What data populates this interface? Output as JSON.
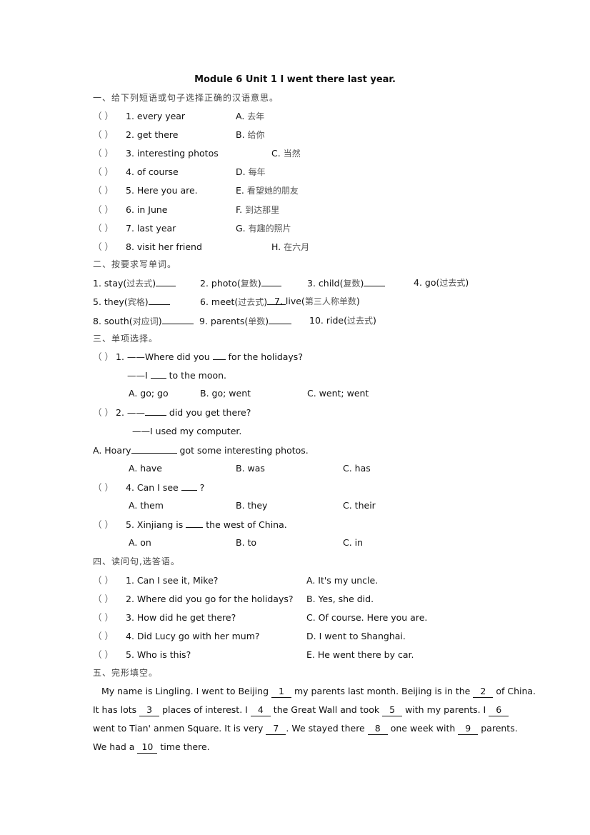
{
  "title": "Module 6 Unit 1 I went there last year.",
  "section1": {
    "heading": "一、给下列短语或句子选择正确的汉语意思。",
    "items": [
      {
        "paren": "（  ）",
        "q": "1. every year",
        "opt": "A.",
        "optcn": "去年"
      },
      {
        "paren": "（  ）",
        "q": "2. get there",
        "opt": "B.",
        "optcn": "给你"
      },
      {
        "paren": "（  ）",
        "q": "3. interesting photos",
        "opt": "C.",
        "optcn": "当然"
      },
      {
        "paren": "（  ）",
        "q": "4. of course",
        "opt": "D.",
        "optcn": "每年"
      },
      {
        "paren": "（  ）",
        "q": "5. Here you are.",
        "opt": "E.",
        "optcn": "看望她的朋友"
      },
      {
        "paren": "（  ）",
        "q": "6. in June",
        "opt": "F.",
        "optcn": "到达那里"
      },
      {
        "paren": "（  ）",
        "q": "7. last year",
        "opt": "G.",
        "optcn": "有趣的照片"
      },
      {
        "paren": "（  ）",
        "q": "8. visit her friend",
        "opt": "H.",
        "optcn": "在六月"
      }
    ]
  },
  "section2": {
    "heading": "二、按要求写单词。",
    "items": [
      {
        "word": "1. stay(",
        "cn": "过去式",
        "close": ")"
      },
      {
        "word": "2. photo(",
        "cn": "复数",
        "close": ")"
      },
      {
        "word": "3. child(",
        "cn": "复数",
        "close": ")"
      },
      {
        "word": "4. go(",
        "cn": "过去式",
        "close": ")"
      },
      {
        "word": "5. they(",
        "cn": "宾格",
        "close": ")"
      },
      {
        "word": "6. meet(",
        "cn": "过去式",
        "close": ")"
      },
      {
        "word": "7. live(",
        "cn": "第三人称单数",
        "close": ")"
      },
      {
        "word": "8. south(",
        "cn": "对应词",
        "close": ")"
      },
      {
        "word": "9. parents(",
        "cn": "单数",
        "close": ")"
      },
      {
        "word": "10. ride(",
        "cn": "过去式",
        "close": ")"
      }
    ]
  },
  "section3": {
    "heading": "三、单项选择。",
    "q1": {
      "paren": "（  ）",
      "a": "1. ——Where did you",
      "b": "for the holidays?",
      "c": "——I",
      "d": "to the moon.",
      "options": [
        "A. go; go",
        "B. go; went",
        "C. went; went"
      ]
    },
    "q2": {
      "paren": "（  ）",
      "a": "2. ——",
      "b": "did you get there?",
      "c": "——I used my computer."
    },
    "q3": {
      "a": "A. Hoary",
      "b": "got some interesting photos.",
      "options": [
        "A. have",
        "B. was",
        "C. has"
      ]
    },
    "q4": {
      "paren": "（  ）",
      "a": "4. Can I see",
      "b": "?",
      "options": [
        "A. them",
        "B. they",
        "C. their"
      ]
    },
    "q5": {
      "paren": "（  ）",
      "a": "5. Xinjiang is",
      "b": "the west of China.",
      "options": [
        "A. on",
        "B. to",
        "C. in"
      ]
    }
  },
  "section4": {
    "heading": "四、读问句,选答语。",
    "items": [
      {
        "paren": "（  ）",
        "q": "1. Can I see it, Mike?",
        "a": "A. It's my uncle."
      },
      {
        "paren": "（  ）",
        "q": "2. Where did you go for the holidays?",
        "a": "B. Yes, she did."
      },
      {
        "paren": "（  ）",
        "q": "3. How did he get there?",
        "a": "C. Of course. Here you are."
      },
      {
        "paren": "（  ）",
        "q": "4. Did Lucy go with her mum?",
        "a": "D. I went to Shanghai."
      },
      {
        "paren": "（  ）",
        "q": "5. Who is this?",
        "a": "E. He went there by car."
      }
    ]
  },
  "section5": {
    "heading": "五、完形填空。",
    "lines": [
      {
        "parts": [
          "My name is Lingling. I went to Beijing ",
          "1",
          " my parents last month. Beijing is in the ",
          "2",
          " of China."
        ]
      },
      {
        "parts": [
          "It has lots ",
          "3",
          " places of interest. I ",
          "4",
          " the Great Wall and took ",
          "5",
          " with my parents. I ",
          "6",
          ""
        ]
      },
      {
        "parts": [
          "went to Tian' anmen Square. It is very ",
          "7",
          ". We stayed there ",
          "8",
          " one week with ",
          "9",
          " parents."
        ]
      },
      {
        "parts": [
          "We had a ",
          "10",
          " time there."
        ]
      }
    ]
  }
}
